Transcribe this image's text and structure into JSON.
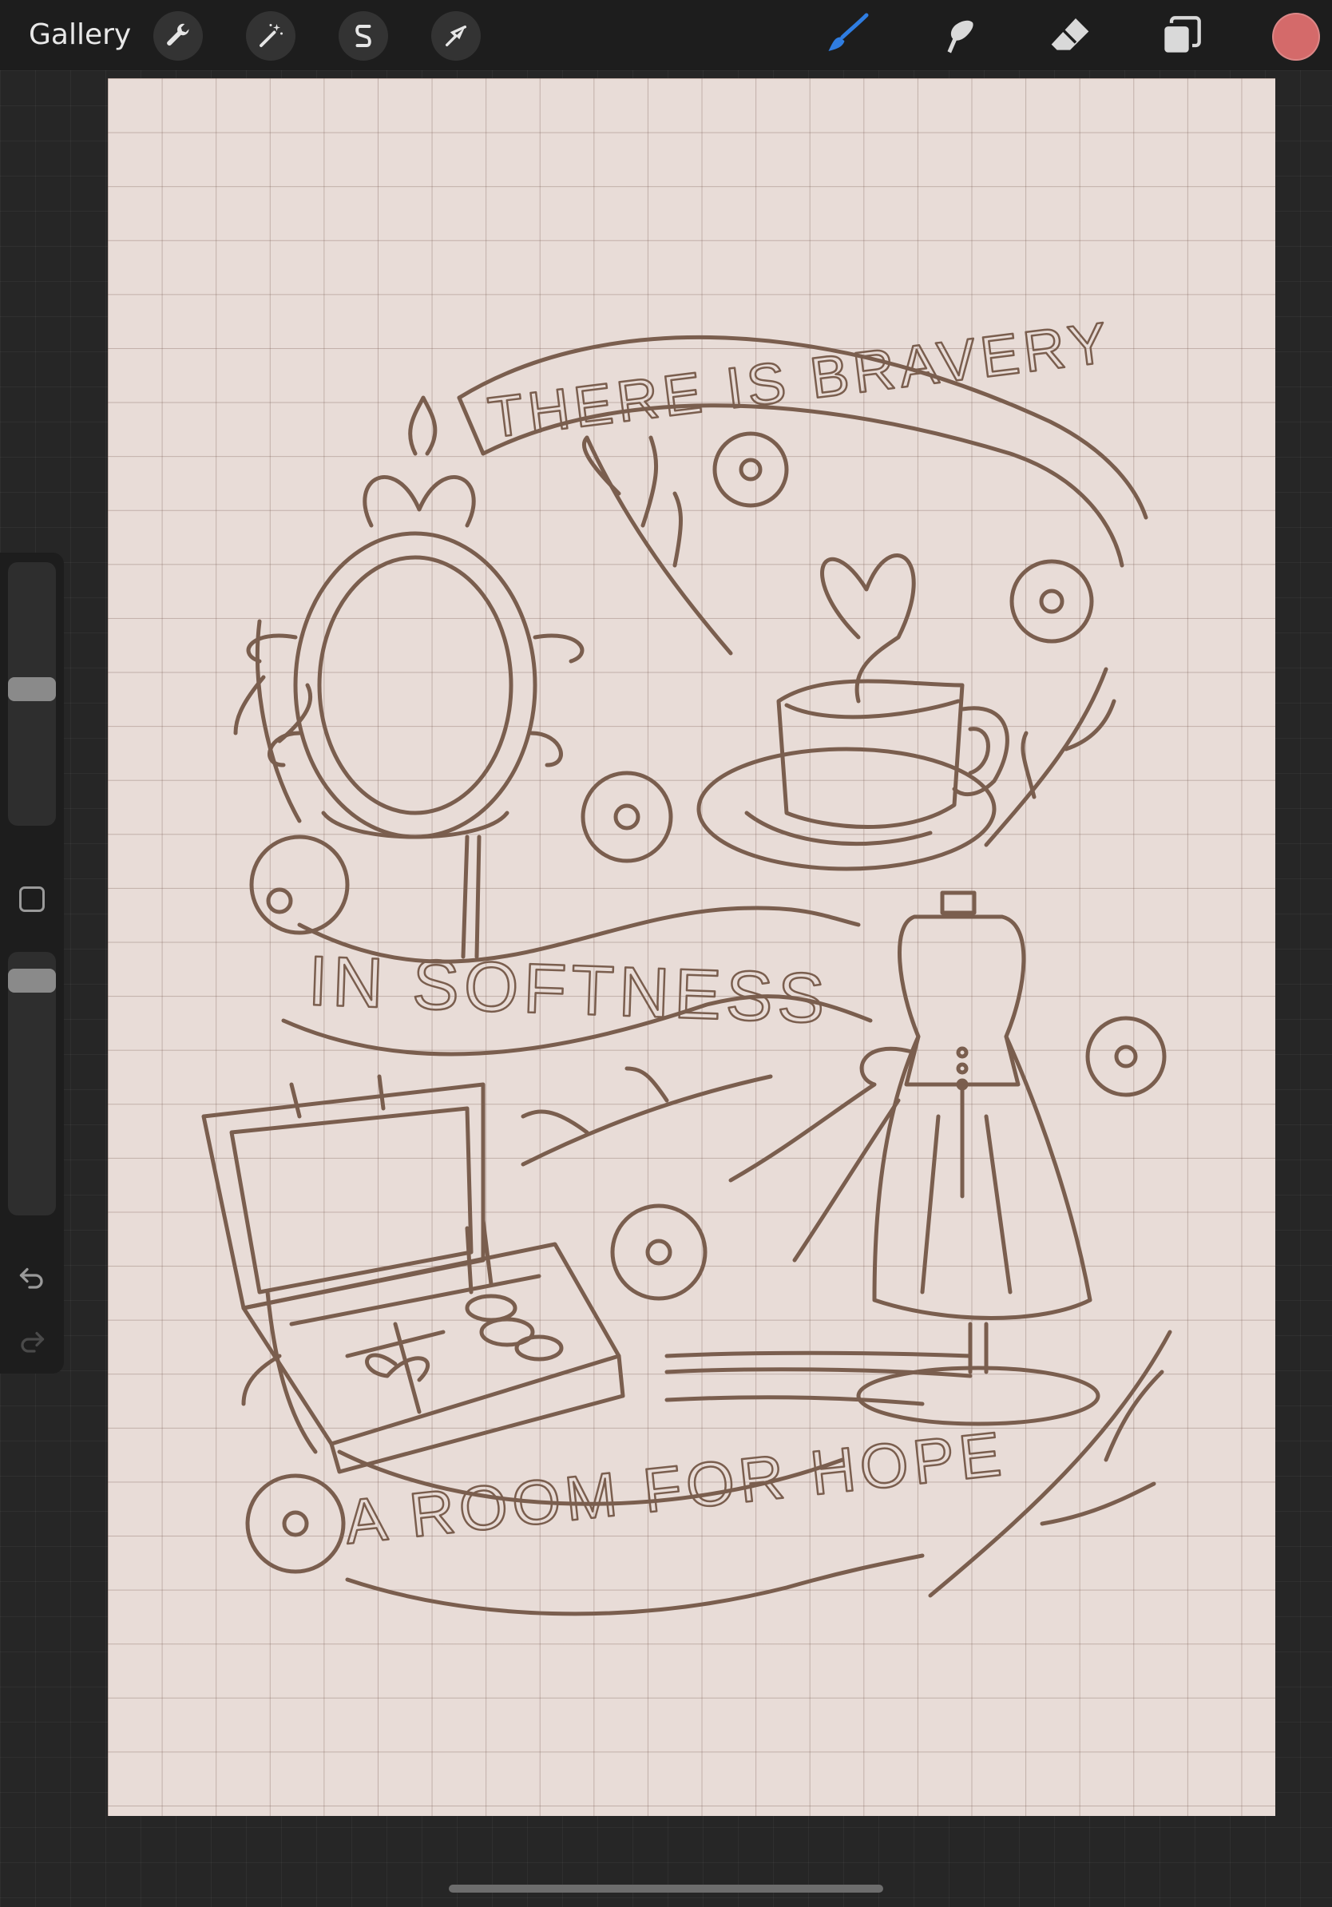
{
  "topbar": {
    "gallery_label": "Gallery",
    "left_tools": [
      {
        "name": "actions",
        "icon": "wrench-icon"
      },
      {
        "name": "adjustments",
        "icon": "magic-wand-icon"
      },
      {
        "name": "selection",
        "icon": "selection-s-icon"
      },
      {
        "name": "transform",
        "icon": "arrow-cursor-icon"
      }
    ],
    "right_tools": [
      {
        "name": "brush",
        "icon": "brush-icon",
        "active": true
      },
      {
        "name": "smudge",
        "icon": "smudge-finger-icon"
      },
      {
        "name": "eraser",
        "icon": "eraser-icon"
      },
      {
        "name": "layers",
        "icon": "layers-icon"
      }
    ],
    "current_color": "#d46a6a",
    "active_color": "#2f7de1"
  },
  "sidebar": {
    "brush_size_level": 0.48,
    "brush_opacity_level": 0.07,
    "undo_icon": "undo-arrow-icon",
    "redo_icon": "redo-arrow-icon",
    "modify_icon": "square-outline-icon"
  },
  "canvas": {
    "paper_color": "#e8dcd7",
    "sketch_color": "#7a5e4e",
    "banner_texts": {
      "top": "THERE IS BRAVERY",
      "middle": "IN SOFTNESS",
      "bottom": "A ROOM FOR HOPE"
    }
  }
}
